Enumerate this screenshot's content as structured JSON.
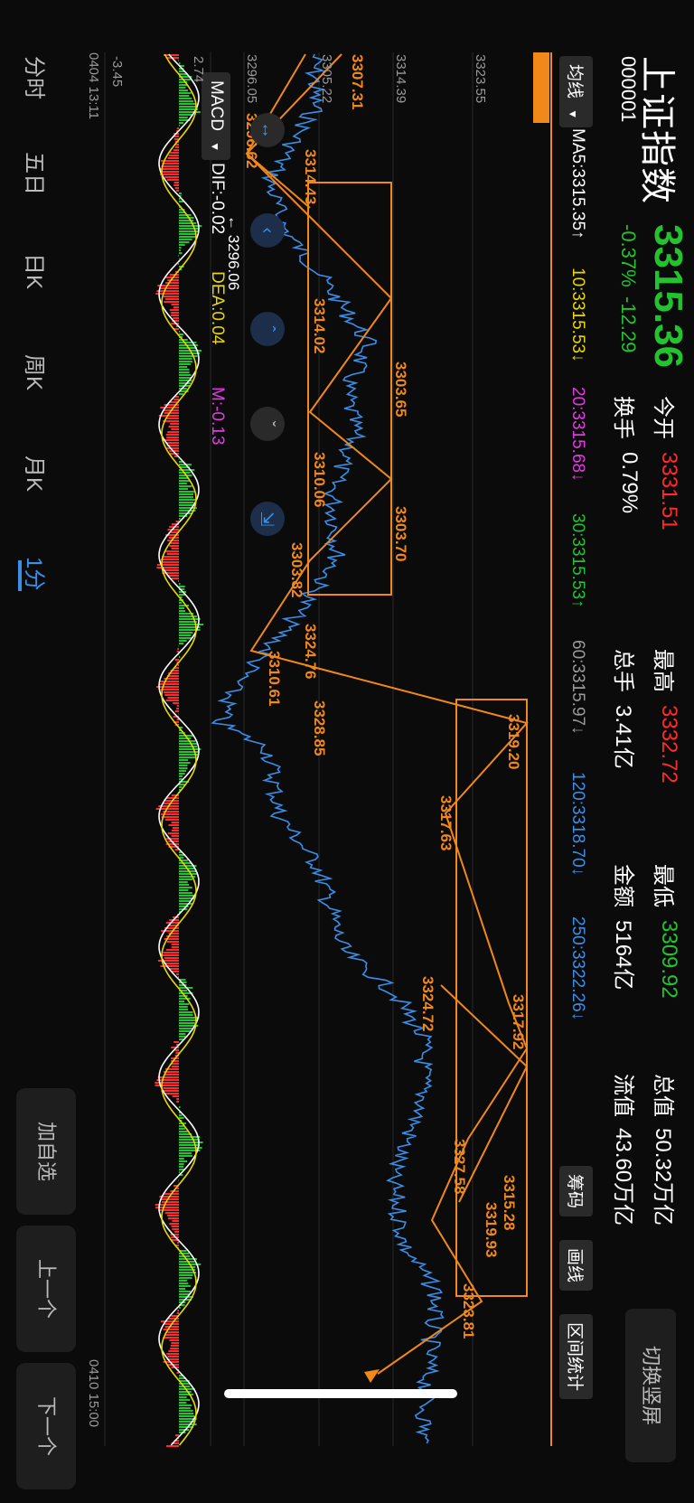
{
  "header": {
    "title": "上证指数",
    "code": "000001",
    "price": "3315.36",
    "change_pct": "-0.37%",
    "change_abs": "-12.29",
    "stats": [
      {
        "label": "今开",
        "value": "3331.51",
        "color": "red"
      },
      {
        "label": "换手",
        "value": "0.79%",
        "color": "white"
      },
      {
        "label": "最高",
        "value": "3332.72",
        "color": "red"
      },
      {
        "label": "总手",
        "value": "3.41亿",
        "color": "white"
      },
      {
        "label": "最低",
        "value": "3309.92",
        "color": "green"
      },
      {
        "label": "金额",
        "value": "5164亿",
        "color": "white"
      },
      {
        "label": "总值",
        "value": "50.32万亿",
        "color": "white"
      },
      {
        "label": "流值",
        "value": "43.60万亿",
        "color": "white"
      }
    ],
    "switch_portrait": "切换竖屏"
  },
  "ma_bar": {
    "selector": "均线",
    "items": [
      {
        "text": "MA5:3315.35↑",
        "color": "#ffffff"
      },
      {
        "text": "10:3315.53↓",
        "color": "#e8d800"
      },
      {
        "text": "20:3315.68↓",
        "color": "#e23be2"
      },
      {
        "text": "30:3315.53↑",
        "color": "#22c32e"
      },
      {
        "text": "60:3315.97↓",
        "color": "#9a9a9a"
      },
      {
        "text": "120:3318.70↓",
        "color": "#3b8fe8"
      },
      {
        "text": "250:3322.26↓",
        "color": "#3b8fe8"
      }
    ]
  },
  "tools": {
    "chips": "筹码",
    "draw": "画线",
    "range_stats": "区间统计"
  },
  "price_axis": [
    "3323.55",
    "3314.39",
    "3305.22",
    "3296.05"
  ],
  "chart_labels": [
    {
      "text": "3307.31"
    },
    {
      "text": "3296.62"
    },
    {
      "text": "3314.43"
    },
    {
      "text": "3314.02"
    },
    {
      "text": "3303.65"
    },
    {
      "text": "3310.06"
    },
    {
      "text": "3303.70"
    },
    {
      "text": "3303.82"
    },
    {
      "text": "3310.61"
    },
    {
      "text": "3324.76"
    },
    {
      "text": "3328.85"
    },
    {
      "text": "3319.20"
    },
    {
      "text": "3317.63"
    },
    {
      "text": "3324.72"
    },
    {
      "text": "3317.92"
    },
    {
      "text": "3327.58"
    },
    {
      "text": "3315.28"
    },
    {
      "text": "3319.93"
    },
    {
      "text": "3323.81"
    }
  ],
  "low_marker": "← 3296.06",
  "macd": {
    "selector": "MACD",
    "dif": "DIF:-0.02",
    "dea": "DEA:0.04",
    "m": "M:-0.13",
    "axis_top": "2.74",
    "axis_bottom": "-3.45"
  },
  "time_axis": {
    "start": "0404 13:11",
    "end": "0410 15:00"
  },
  "tabs": [
    {
      "label": "分时",
      "active": false
    },
    {
      "label": "五日",
      "active": false
    },
    {
      "label": "日K",
      "active": false
    },
    {
      "label": "周K",
      "active": false
    },
    {
      "label": "月K",
      "active": false
    },
    {
      "label": "1分",
      "active": true
    }
  ],
  "buttons": {
    "add_watch": "加自选",
    "prev": "上一个",
    "next": "下一个"
  },
  "colors": {
    "up": "#ff2a2a",
    "down": "#22c32e",
    "accent": "#f0881a",
    "line": "#3b8fe8",
    "bg": "#0b0b0b"
  }
}
